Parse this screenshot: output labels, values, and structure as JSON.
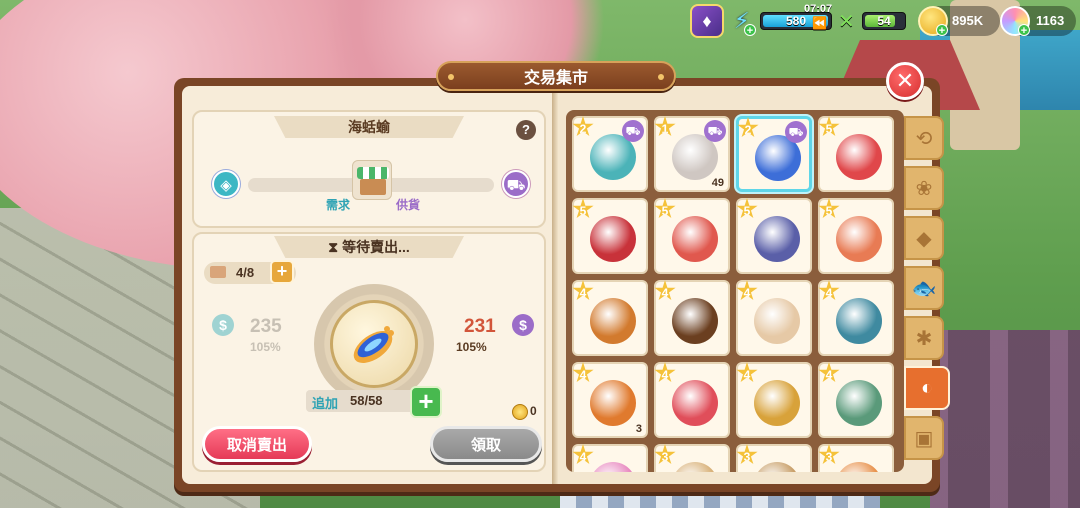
{
  "hud": {
    "badge_icon": "card-deck-icon",
    "energy": {
      "value": "580",
      "fill_fraction": 0.95,
      "icon": "lightning-icon"
    },
    "timer": {
      "text": "07:07",
      "icon": "rewind-icon"
    },
    "food": {
      "value": "54",
      "fill_fraction": 0.75,
      "icon": "fork-knife-icon"
    },
    "coins": {
      "value": "895K",
      "icon": "coin-icon"
    },
    "gems": {
      "value": "1163",
      "icon": "rainbow-gem-icon"
    }
  },
  "window": {
    "title": "交易集市",
    "close_icon": "close-icon"
  },
  "item_info": {
    "name": "海蛞蝓",
    "help": "?",
    "demand_label": "需求",
    "supply_label": "供貨"
  },
  "sale": {
    "status": "等待賣出...",
    "slots": "4/8",
    "slots_plus": "+",
    "sell_price": "235",
    "sell_pct": "105%",
    "buy_price": "231",
    "buy_pct": "105%",
    "currency_symbol": "$",
    "add_label": "追加",
    "add_value": "58/58",
    "add_plus": "+",
    "coin_value": "0",
    "cancel_label": "取消賣出",
    "claim_label": "領取"
  },
  "grid_items": [
    {
      "rank": "2",
      "cart": true,
      "count": "",
      "icon": "teal-shell-icon",
      "color": "#4bb3b8",
      "selected": false
    },
    {
      "rank": "1",
      "cart": true,
      "count": "49",
      "icon": "oyster-icon",
      "color": "#cfc7c2",
      "selected": false
    },
    {
      "rank": "2",
      "cart": true,
      "count": "",
      "icon": "sea-slug-icon",
      "color": "#3d6ed8",
      "selected": true
    },
    {
      "rank": "5",
      "cart": false,
      "count": "",
      "icon": "red-crab-icon",
      "color": "#e0474a",
      "selected": false
    },
    {
      "rank": "5",
      "cart": false,
      "count": "",
      "icon": "lobster-icon",
      "color": "#c8323a",
      "selected": false
    },
    {
      "rank": "5",
      "cart": false,
      "count": "",
      "icon": "king-crab-icon",
      "color": "#e0584e",
      "selected": false
    },
    {
      "rank": "5",
      "cart": false,
      "count": "",
      "icon": "purple-clam-cluster-icon",
      "color": "#5a5fa8",
      "selected": false
    },
    {
      "rank": "5",
      "cart": false,
      "count": "",
      "icon": "scallop-icon",
      "color": "#e87b54",
      "selected": false
    },
    {
      "rank": "4",
      "cart": false,
      "count": "",
      "icon": "heart-shell-icon",
      "color": "#d27a2e",
      "selected": false
    },
    {
      "rank": "4",
      "cart": false,
      "count": "",
      "icon": "sea-cucumber-icon",
      "color": "#6b3f20",
      "selected": false
    },
    {
      "rank": "4",
      "cart": false,
      "count": "",
      "icon": "squid-icon",
      "color": "#e6c9a6",
      "selected": false
    },
    {
      "rank": "4",
      "cart": false,
      "count": "",
      "icon": "spiny-lobster-icon",
      "color": "#3f8aa0",
      "selected": false
    },
    {
      "rank": "4",
      "cart": false,
      "count": "3",
      "icon": "hermit-crab-icon",
      "color": "#e07a2e",
      "selected": false
    },
    {
      "rank": "4",
      "cart": false,
      "count": "",
      "icon": "starfish-icon",
      "color": "#e04e5a",
      "selected": false
    },
    {
      "rank": "4",
      "cart": false,
      "count": "",
      "icon": "golden-shell-icon",
      "color": "#d8a23a",
      "selected": false
    },
    {
      "rank": "4",
      "cart": false,
      "count": "",
      "icon": "conch-icon",
      "color": "#5a9a7a",
      "selected": false
    },
    {
      "rank": "4",
      "cart": false,
      "count": "",
      "icon": "pink-coral-icon",
      "color": "#e88ac0",
      "selected": false
    },
    {
      "rank": "3",
      "cart": false,
      "count": "",
      "icon": "shell-icon",
      "color": "#d9b27a",
      "selected": false
    },
    {
      "rank": "3",
      "cart": false,
      "count": "",
      "icon": "shell-icon",
      "color": "#c9a06a",
      "selected": false
    },
    {
      "rank": "3",
      "cart": false,
      "count": "",
      "icon": "shrimp-icon",
      "color": "#e8934e",
      "selected": false
    }
  ],
  "tabs": [
    {
      "icon": "history-icon",
      "glyph": "⟲",
      "active": false
    },
    {
      "icon": "plant-icon",
      "glyph": "❀",
      "active": false
    },
    {
      "icon": "ore-icon",
      "glyph": "◆",
      "active": false
    },
    {
      "icon": "fish-icon",
      "glyph": "🐟",
      "active": false
    },
    {
      "icon": "bug-icon",
      "glyph": "✱",
      "active": false
    },
    {
      "icon": "seashell-icon",
      "glyph": "◐",
      "active": true
    },
    {
      "icon": "misc-icon",
      "glyph": "▣",
      "active": false
    }
  ]
}
